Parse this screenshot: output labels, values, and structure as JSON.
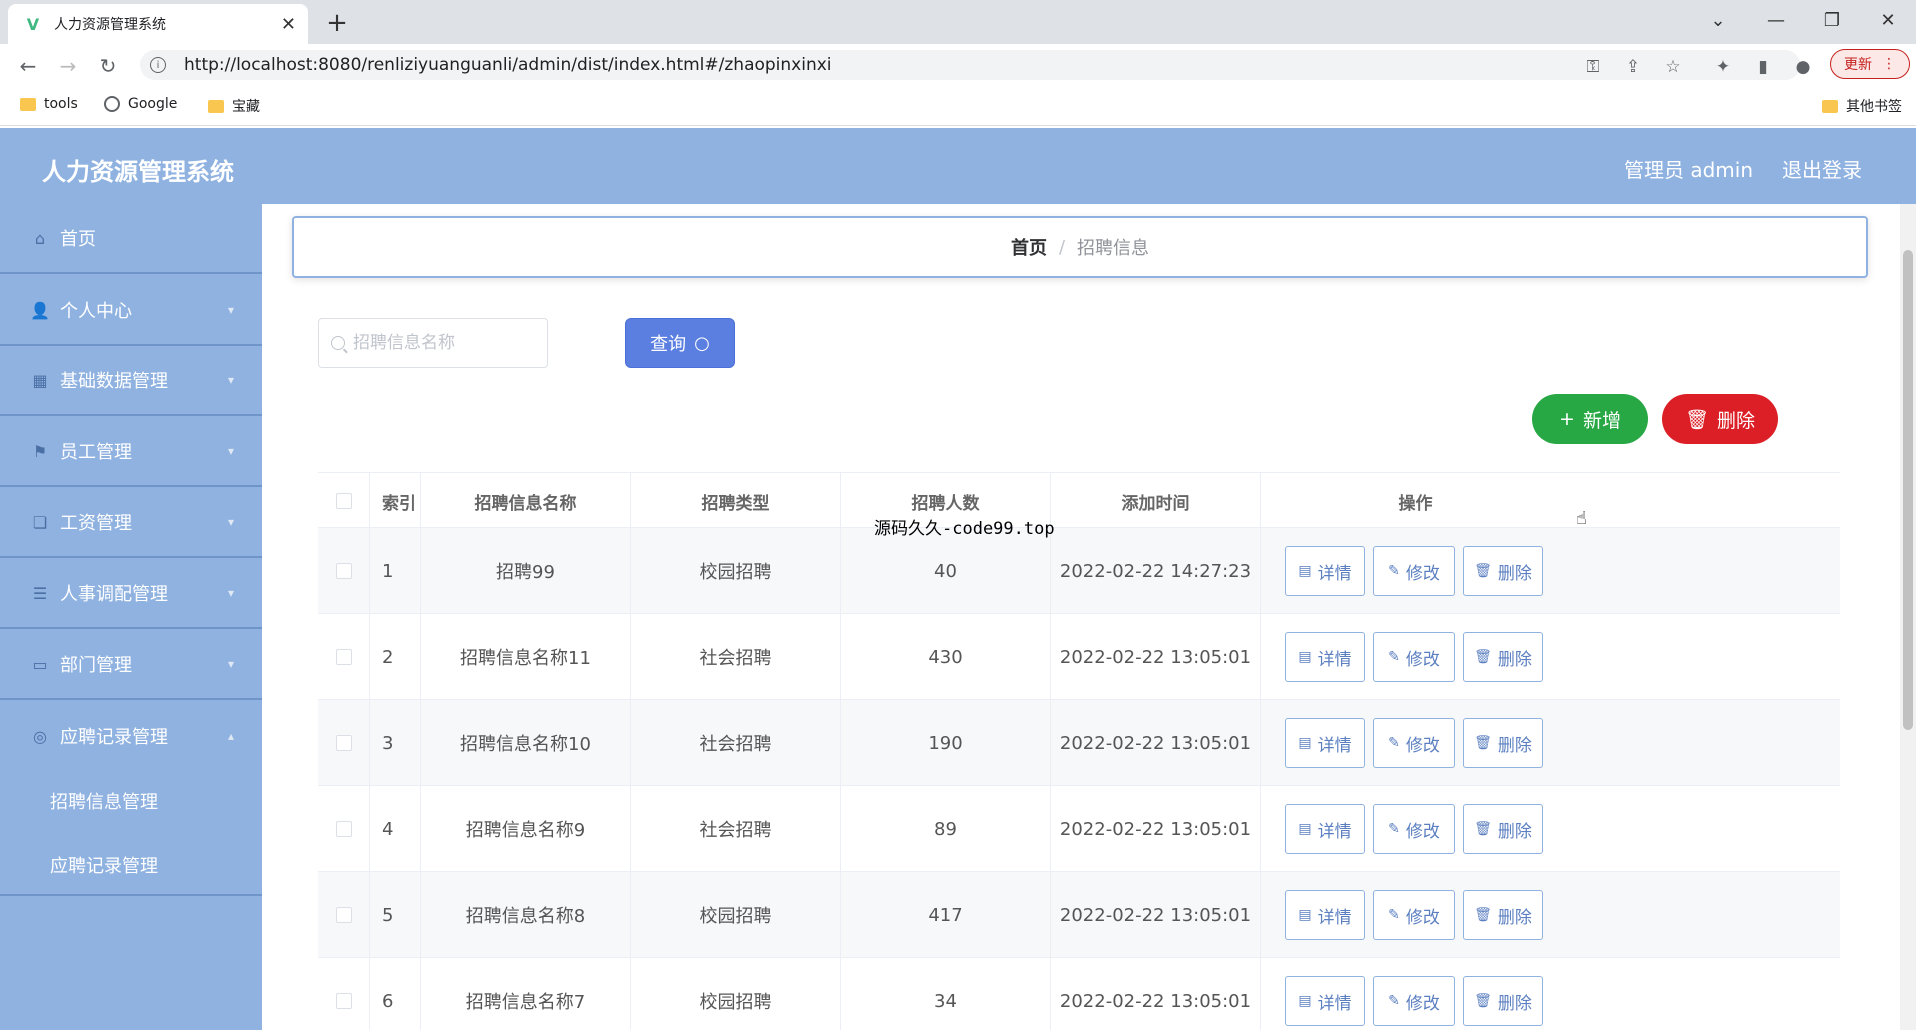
{
  "browser": {
    "tab_title": "人力资源管理系统",
    "url": "http://localhost:8080/renliziyuanguanli/admin/dist/index.html#/zhaopinxinxi",
    "update_label": "更新",
    "bookmarks": [
      "tools",
      "Google",
      "宝藏"
    ],
    "other_bookmarks": "其他书签"
  },
  "app": {
    "title": "人力资源管理系统",
    "user": "管理员 admin",
    "logout": "退出登录"
  },
  "sidebar": {
    "items": [
      {
        "label": "首页"
      },
      {
        "label": "个人中心"
      },
      {
        "label": "基础数据管理"
      },
      {
        "label": "员工管理"
      },
      {
        "label": "工资管理"
      },
      {
        "label": "人事调配管理"
      },
      {
        "label": "部门管理"
      },
      {
        "label": "应聘记录管理"
      }
    ],
    "submenu": [
      "招聘信息管理",
      "应聘记录管理"
    ]
  },
  "breadcrumb": {
    "home": "首页",
    "separator": "/",
    "current": "招聘信息"
  },
  "search": {
    "placeholder": "招聘信息名称",
    "button": "查询"
  },
  "actions": {
    "add": "新增",
    "delete": "删除"
  },
  "table": {
    "headers": [
      "索引",
      "招聘信息名称",
      "招聘类型",
      "招聘人数",
      "添加时间",
      "操作"
    ],
    "rows": [
      {
        "index": "1",
        "name": "招聘99",
        "type": "校园招聘",
        "count": "40",
        "time": "2022-02-22 14:27:23"
      },
      {
        "index": "2",
        "name": "招聘信息名称11",
        "type": "社会招聘",
        "count": "430",
        "time": "2022-02-22 13:05:01"
      },
      {
        "index": "3",
        "name": "招聘信息名称10",
        "type": "社会招聘",
        "count": "190",
        "time": "2022-02-22 13:05:01"
      },
      {
        "index": "4",
        "name": "招聘信息名称9",
        "type": "社会招聘",
        "count": "89",
        "time": "2022-02-22 13:05:01"
      },
      {
        "index": "5",
        "name": "招聘信息名称8",
        "type": "校园招聘",
        "count": "417",
        "time": "2022-02-22 13:05:01"
      },
      {
        "index": "6",
        "name": "招聘信息名称7",
        "type": "校园招聘",
        "count": "34",
        "time": "2022-02-22 13:05:01"
      }
    ],
    "row_actions": {
      "detail": "详情",
      "edit": "修改",
      "delete": "删除"
    }
  },
  "overlay_text": "源码久久-code99.top"
}
